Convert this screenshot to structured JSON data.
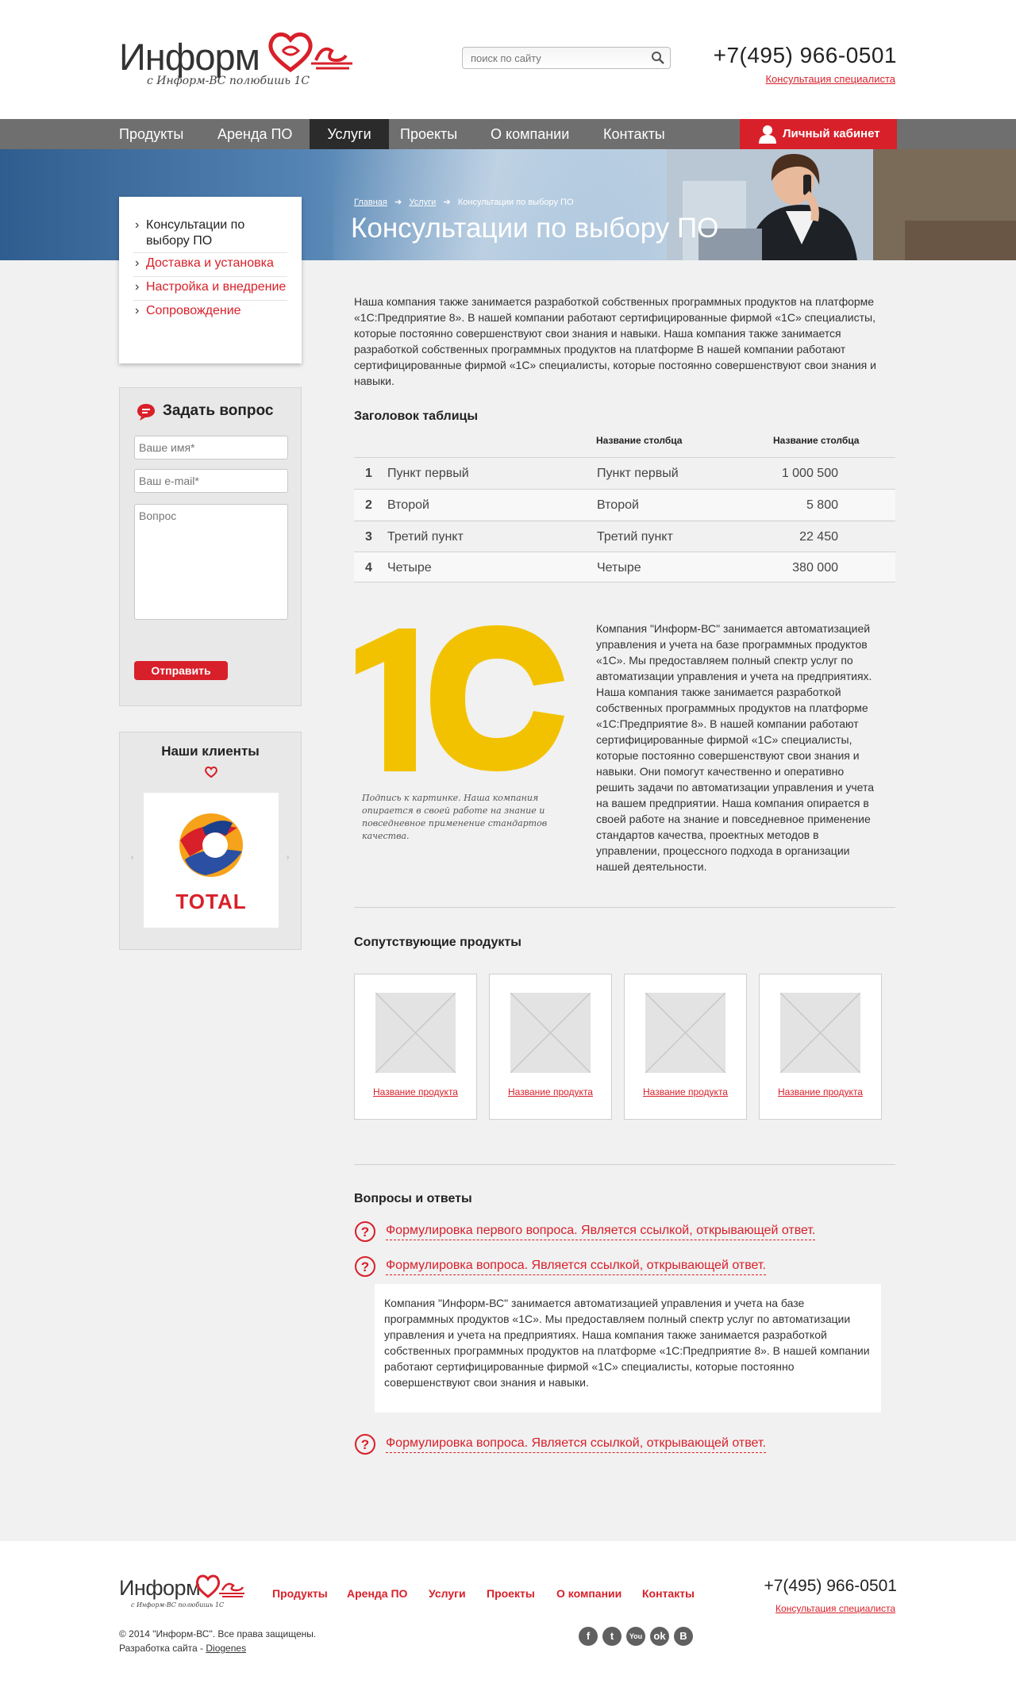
{
  "header": {
    "logo_word": "Информ",
    "logo_tagline": "с Информ-ВС полюбишь 1С",
    "search_placeholder": "поиск по сайту",
    "phone": "+7(495) 966-0501",
    "consult_link": "Консультация специалиста"
  },
  "nav": {
    "items": [
      "Продукты",
      "Аренда ПО",
      "Услуги",
      "Проекты",
      "О компании",
      "Контакты"
    ],
    "active": "Услуги",
    "cabinet_label": "Личный кабинет"
  },
  "banner": {
    "breadcrumb": [
      "Главная",
      "Услуги",
      "Консультации по выбору ПО"
    ],
    "title": "Консультации по выбору ПО"
  },
  "submenu": {
    "items": [
      "Консультации по выбору ПО",
      "Доставка и установка",
      "Настройка и внедрение",
      "Сопровождение"
    ]
  },
  "ask": {
    "title": "Задать вопрос",
    "name_placeholder": "Ваше имя*",
    "email_placeholder": "Ваш e-mail*",
    "question_placeholder": "Вопрос",
    "submit_label": "Отправить"
  },
  "clients": {
    "title": "Наши клиенты",
    "logo_text": "TOTAL"
  },
  "intro_text": "Наша компания также занимается разработкой собственных программных продуктов на платформе «1С:Предприятие 8». В нашей компании работают сертифицированные фирмой «1С» специалисты, которые постоянно совершенствуют свои знания и навыки. Наша компания также занимается разработкой собственных программных продуктов на платформе  В нашей компании работают сертифицированные фирмой «1С» специалисты, которые постоянно совершенствуют свои знания и навыки.",
  "table": {
    "title": "Заголовок таблицы",
    "headers": [
      "Название столбца",
      "Название столбца"
    ],
    "rows": [
      {
        "n": "1",
        "c1": "Пункт первый",
        "c2": "Пункт первый",
        "c3": "1 000 500"
      },
      {
        "n": "2",
        "c1": "Второй",
        "c2": "Второй",
        "c3": "5 800"
      },
      {
        "n": "3",
        "c1": "Третий пункт",
        "c2": "Третий пункт",
        "c3": "22 450"
      },
      {
        "n": "4",
        "c1": "Четыре",
        "c2": "Четыре",
        "c3": "380 000"
      }
    ]
  },
  "figure": {
    "logo_text": "1С",
    "caption": "Подпись к картинке. Наша компания опирается в своей работе на знание и повседневное применение стандартов качества."
  },
  "company_text": "Компания \"Информ-ВС\" занимается автоматизацией управления и учета на базе программных продуктов «1С». Мы предоставляем полный спектр услуг по автоматизации управления и учета на предприятиях. Наша компания также занимается разработкой собственных программных продуктов на платформе «1С:Предприятие 8». В нашей компании работают сертифицированные фирмой «1С» специалисты, которые постоянно совершенствуют свои знания и навыки. Они помогут качественно и оперативно решить задачи по автоматизации управления и учета на вашем предприятии. Наша компания опирается в своей работе на знание и повседневное применение стандартов качества, проектных методов в управлении, процессного подхода в организации нашей деятельности.",
  "related": {
    "title": "Сопутствующие продукты",
    "products": [
      "Название продукта",
      "Название продукта",
      "Название продукта",
      "Название продукта"
    ]
  },
  "faq": {
    "title": "Вопросы и ответы",
    "q1": "Формулировка первого вопроса. Является ссылкой, открывающей ответ.",
    "q2": "Формулировка вопроса. Является ссылкой, открывающей ответ.",
    "q3": "Формулировка вопроса. Является ссылкой, открывающей ответ.",
    "answer": "Компания \"Информ-ВС\" занимается автоматизацией управления и учета на базе программных продуктов «1С». Мы предоставляем полный спектр услуг по автоматизации управления и учета на предприятиях. Наша компания также занимается разработкой собственных программных продуктов на платформе «1С:Предприятие 8». В нашей компании работают сертифицированные фирмой «1С» специалисты, которые постоянно совершенствуют свои знания и навыки."
  },
  "footer": {
    "logo_word": "Информ",
    "logo_tagline": "с Информ-ВС полюбишь 1С",
    "nav": [
      "Продукты",
      "Аренда ПО",
      "Услуги",
      "Проекты",
      "О компании",
      "Контакты"
    ],
    "phone": "+7(495) 966-0501",
    "consult_link": "Консультация специалиста",
    "copyright": "© 2014 \"Информ-ВС\". Все права защищены.",
    "dev_prefix": "Разработка сайта - ",
    "dev_link": "Diogenes",
    "social": [
      "facebook-icon",
      "twitter-icon",
      "youtube-icon",
      "odnoklassniki-icon",
      "vk-icon"
    ]
  },
  "colors": {
    "accent": "#d8202a",
    "nav": "#6f6f6f",
    "logo_1c": "#f2c200"
  }
}
